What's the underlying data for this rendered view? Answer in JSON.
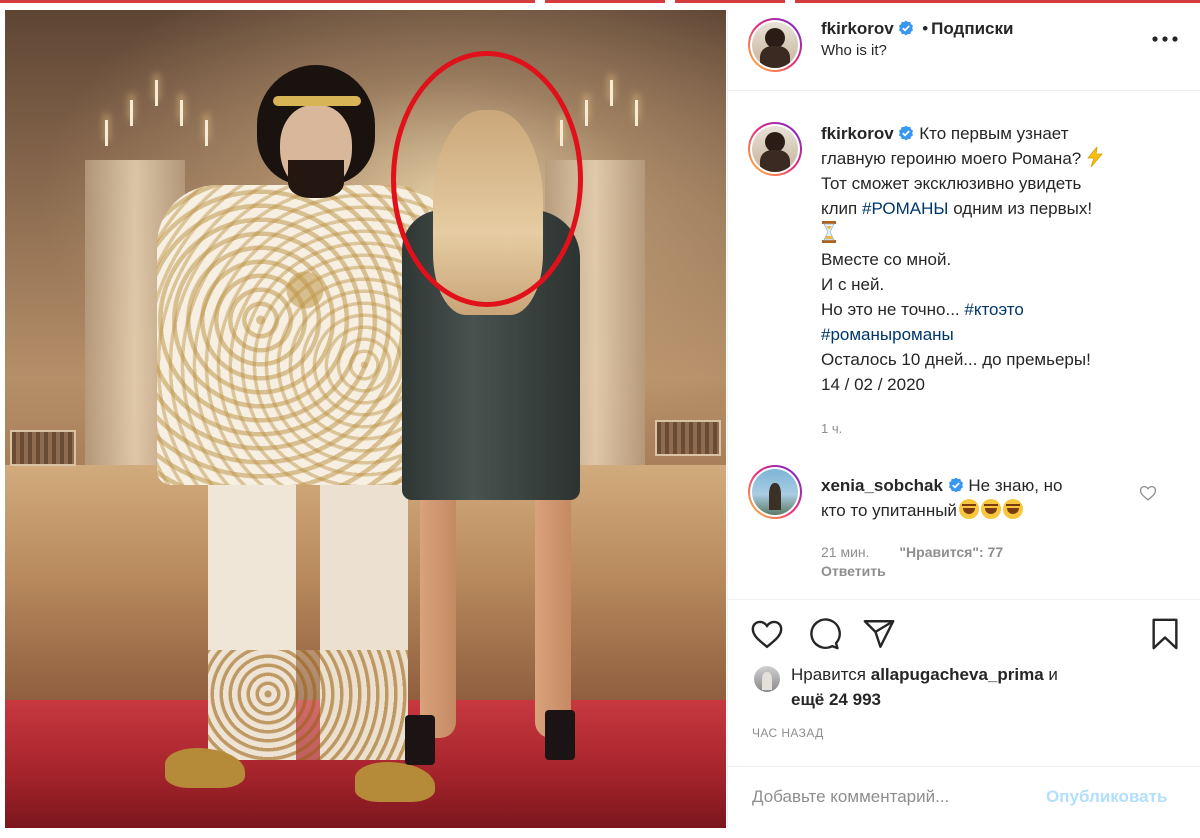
{
  "post": {
    "author": "fkirkorov",
    "follow_label": "Подписки",
    "separator": "•",
    "location": "Who is it?",
    "caption": {
      "line1": "Кто первым узнает",
      "line2": "главную героиню моего Романа?",
      "line3": "Тот сможет эксклюзивно увидеть",
      "line4_prefix": "клип",
      "line4_tag": "#РОМАНЫ",
      "line4_suffix": "одним из первых!",
      "line5": "Вместе со мной.",
      "line6": "И с ней.",
      "line7_prefix": "Но это не точно...",
      "line7_tag": "#ктоэто",
      "line8_tag": "#романыроманы",
      "line9": "Осталось 10 дней... до премьеры!",
      "line10": "14 / 02 / 2020",
      "time": "1 ч."
    },
    "comment": {
      "author": "xenia_sobchak",
      "text_line1": "Не знаю, но",
      "text_line2": "кто то упитанный",
      "time": "21 мин.",
      "likes": "\"Нравится\": 77",
      "reply": "Ответить"
    },
    "likes": {
      "prefix": "Нравится",
      "user": "allapugacheva_prima",
      "joiner": "и",
      "others": "ещё 24 993"
    },
    "posted": "ЧАС НАЗАД",
    "add_comment_placeholder": "Добавьте комментарий...",
    "publish_label": "Опубликовать"
  },
  "icons": {
    "more": "more-horizontal-icon",
    "verified": "verified-badge-icon",
    "heart": "heart-icon",
    "comment": "comment-icon",
    "share": "share-icon",
    "save": "bookmark-icon"
  },
  "colors": {
    "verified": "#3897f0",
    "hashtag": "#00376b",
    "muted": "#8e8e8e",
    "publish_disabled": "#b2dffc",
    "annotation_circle": "#e0111b"
  }
}
